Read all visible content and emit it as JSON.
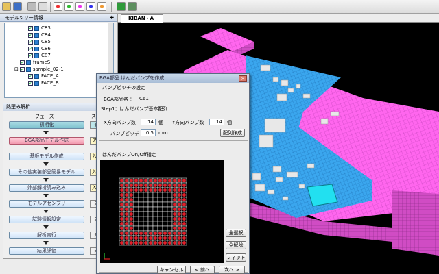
{
  "toolbar": {
    "buttons": [
      "folder-icon",
      "save-icon",
      "print-icon",
      "copy-icon",
      "mesh-a-icon",
      "mesh-b-icon",
      "mesh-c-icon",
      "mesh-d-icon",
      "mesh-e-icon",
      "view-solid-icon",
      "view-shade-icon"
    ]
  },
  "model_tree": {
    "title": "モデルツリー情報",
    "pin": "✚",
    "items": [
      {
        "label": "C83",
        "level": 2
      },
      {
        "label": "C84",
        "level": 2
      },
      {
        "label": "C85",
        "level": 2
      },
      {
        "label": "C86",
        "level": 2
      },
      {
        "label": "C87",
        "level": 2
      },
      {
        "label": "frameS",
        "level": 1
      },
      {
        "label": "sample_02-1",
        "level": 1
      },
      {
        "label": "FACE_A",
        "level": 2
      },
      {
        "label": "FACE_B",
        "level": 2
      }
    ]
  },
  "process": {
    "title": "熱歪み解析",
    "col_phase": "フェーズ",
    "col_status": "ス",
    "steps": [
      {
        "label": "初期化",
        "status": "完",
        "state": "done"
      },
      {
        "label": "BGA部品モデル作成",
        "status": "アク",
        "state": "active"
      },
      {
        "label": "基板モデル作成",
        "status": "入力",
        "state": "pending"
      },
      {
        "label": "その他実装部品簡易モデル",
        "status": "入力",
        "state": "pending"
      },
      {
        "label": "外部解析読み込み",
        "status": "入力",
        "state": "pending"
      },
      {
        "label": "モデルアセンブリ",
        "status": "未",
        "state": "todo"
      },
      {
        "label": "試験情報設定",
        "status": "未",
        "state": "todo"
      },
      {
        "label": "解析実行",
        "status": "未",
        "state": "todo"
      },
      {
        "label": "結果評価",
        "status": "未",
        "state": "todo"
      }
    ]
  },
  "view_tab": "KIBAN・A",
  "dialog": {
    "title": "BGA部品 はんだバンプを作成",
    "close": "×",
    "group1_label": "バンプピッチの設定",
    "part_name_label": "BGA部品名 ：",
    "part_name": "C61",
    "step_text": "Step1：はんだバンプ基本配列",
    "x_count_label": "X方向バンプ数",
    "x_count": "14",
    "x_unit": "個",
    "y_count_label": "Y方向バンプ数",
    "y_count": "14",
    "y_unit": "個",
    "pitch_label": "バンプピッチ",
    "pitch": "0.5",
    "pitch_unit": "mm",
    "arrange_button": "配列作成",
    "group2_label": "はんだバンプOn/Off指定",
    "select_all": "全選択",
    "deselect_all": "全解除",
    "fit": "フィット",
    "cancel": "キャンセル",
    "back": "< 前へ",
    "next": "次へ >",
    "grid": {
      "rows": 14,
      "cols": 14,
      "ring_width": 3
    }
  },
  "colors": {
    "pink": "#ff66ee",
    "blue": "#3aa6ee",
    "cyan": "#22e0f0",
    "bump_red": "#e0202a",
    "grid_line": "#ffffff"
  }
}
